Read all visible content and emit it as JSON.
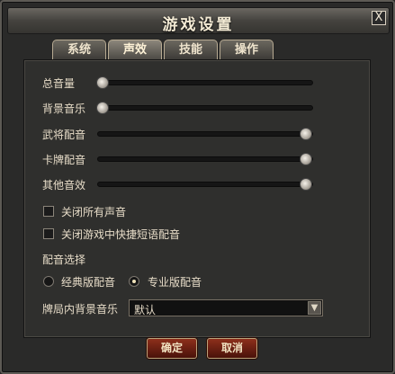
{
  "dialog": {
    "title": "游戏设置",
    "close_label": "X"
  },
  "tabs": [
    {
      "label": "系统",
      "active": false
    },
    {
      "label": "声效",
      "active": true
    },
    {
      "label": "技能",
      "active": false
    },
    {
      "label": "操作",
      "active": false
    }
  ],
  "sliders": [
    {
      "label": "总音量",
      "level": 0.0
    },
    {
      "label": "背景音乐",
      "level": 0.0
    },
    {
      "label": "武将配音",
      "level": 1.0
    },
    {
      "label": "卡牌配音",
      "level": 1.0
    },
    {
      "label": "其他音效",
      "level": 1.0
    }
  ],
  "checkboxes": [
    {
      "label": "关闭所有声音",
      "checked": false
    },
    {
      "label": "关闭游戏中快捷短语配音",
      "checked": false
    }
  ],
  "voice_selection": {
    "label": "配音选择",
    "options": [
      {
        "label": "经典版配音",
        "selected": false
      },
      {
        "label": "专业版配音",
        "selected": true
      }
    ]
  },
  "bgm_in_game": {
    "label": "牌局内背景音乐",
    "value": "默认",
    "arrow": "▼"
  },
  "buttons": {
    "confirm": "确定",
    "cancel": "取消"
  }
}
